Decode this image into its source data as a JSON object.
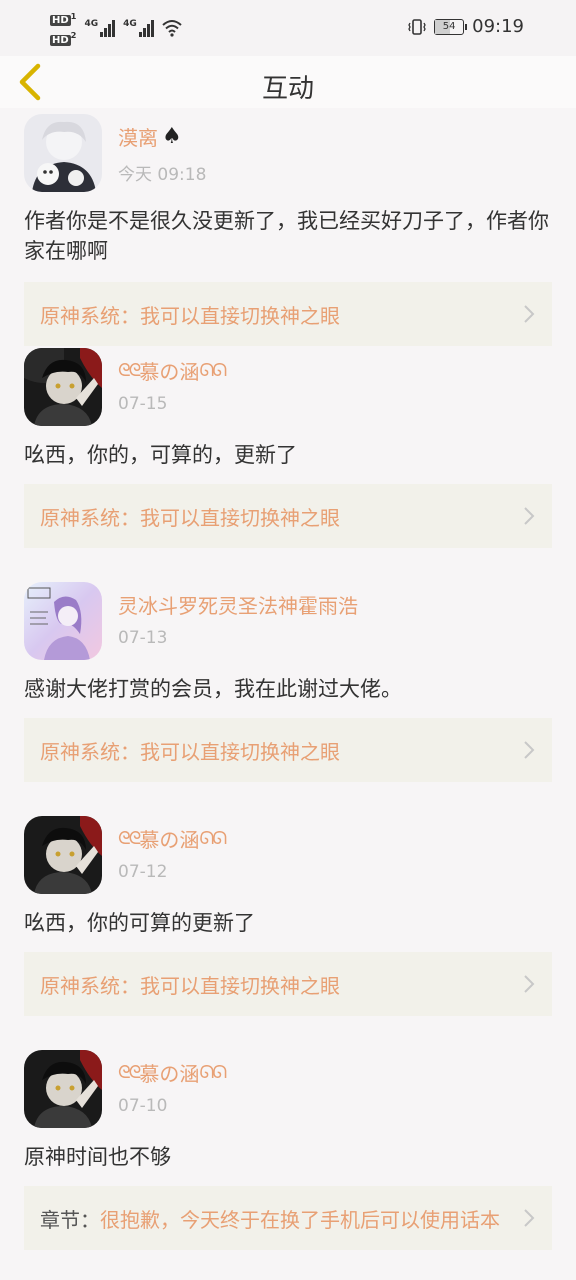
{
  "status": {
    "time": "09:19",
    "battery": "54",
    "battery_level": 0.54,
    "hd1": "HD",
    "hd2": "HD",
    "sig1": "4G",
    "sig2": "4G",
    "icons": [
      "hd-icon",
      "signal-icon",
      "wifi-icon",
      "vibrate-icon",
      "battery-icon"
    ]
  },
  "nav": {
    "title": "互动",
    "back_icon": "chevron-left-icon"
  },
  "colors": {
    "accent": "#e8a074",
    "card_bg": "#f2f1ea",
    "back_icon": "#d8b400"
  },
  "comments": [
    {
      "user": "漠离",
      "badge": "♠",
      "time": "今天 09:18",
      "text": "作者你是不是很久没更新了，我已经买好刀子了，作者你家在哪啊",
      "link": {
        "prefix": "",
        "text": "原神系统：我可以直接切换神之眼"
      }
    },
    {
      "user": "慕の涵",
      "deco_left": "ᘓᘓ",
      "deco_right": "ᘏᘏ",
      "time": "07-15",
      "text": "吆西，你的，可算的，更新了",
      "link": {
        "prefix": "",
        "text": "原神系统：我可以直接切换神之眼"
      }
    },
    {
      "user": "灵冰斗罗死灵圣法神霍雨浩",
      "time": "07-13",
      "text": "感谢大佬打赏的会员，我在此谢过大佬。",
      "link": {
        "prefix": "",
        "text": "原神系统：我可以直接切换神之眼"
      }
    },
    {
      "user": "慕の涵",
      "deco_left": "ᘓᘓ",
      "deco_right": "ᘏᘏ",
      "time": "07-12",
      "text": "吆西，你的可算的更新了",
      "link": {
        "prefix": "",
        "text": "原神系统：我可以直接切换神之眼"
      }
    },
    {
      "user": "慕の涵",
      "deco_left": "ᘓᘓ",
      "deco_right": "ᘏᘏ",
      "time": "07-10",
      "text": "原神时间也不够",
      "link": {
        "prefix": "章节：",
        "text": "很抱歉，今天终于在换了手机后可以使用话本"
      }
    }
  ]
}
